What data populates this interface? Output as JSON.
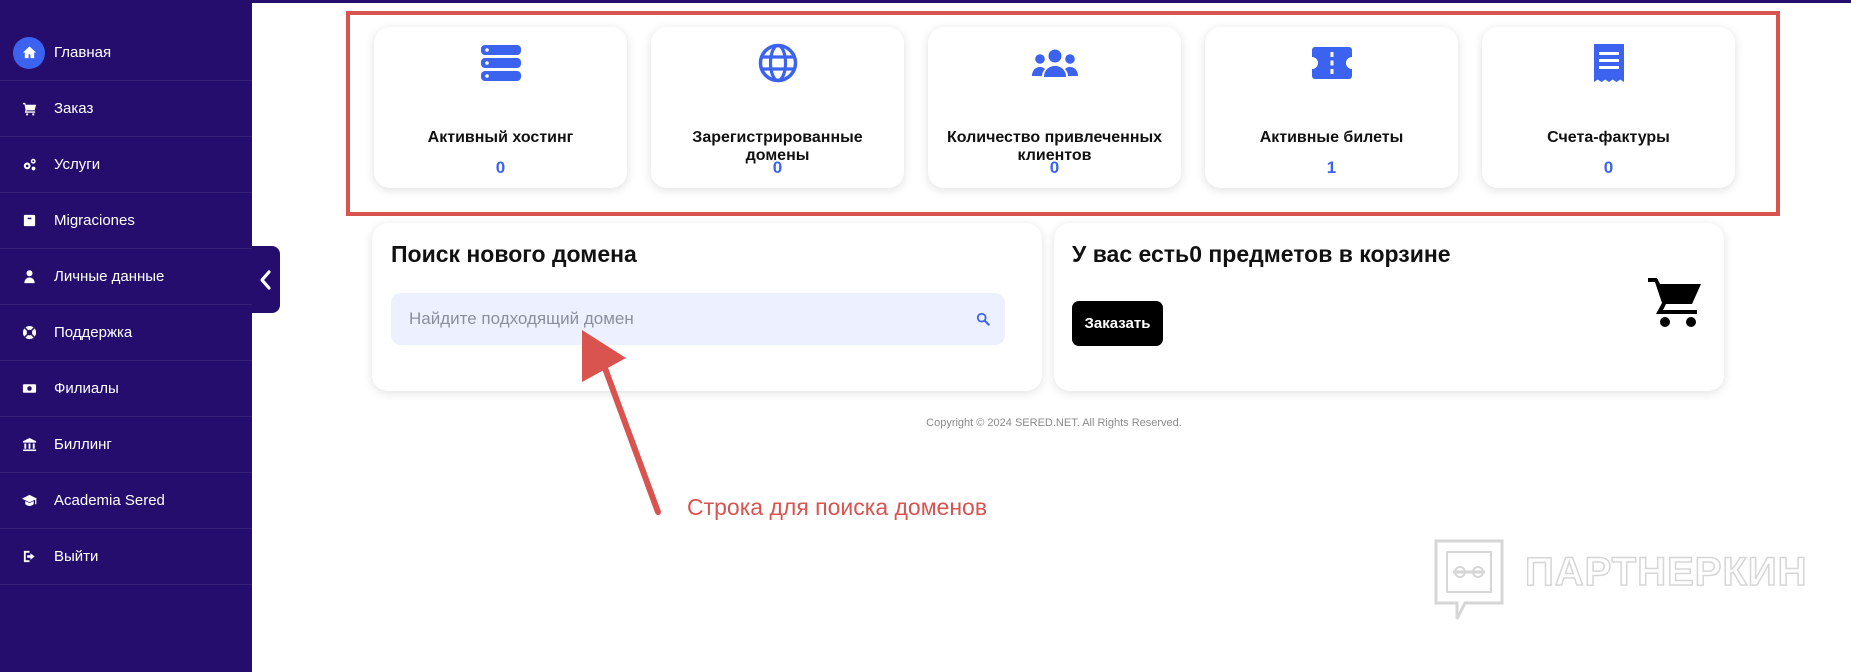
{
  "sidebar": {
    "items": [
      {
        "label": "Главная",
        "icon": "home-icon"
      },
      {
        "label": "Заказ",
        "icon": "cart-icon"
      },
      {
        "label": "Услуги",
        "icon": "gears-icon"
      },
      {
        "label": "Migraciones",
        "icon": "box-icon"
      },
      {
        "label": "Личные данные",
        "icon": "user-icon"
      },
      {
        "label": "Поддержка",
        "icon": "lifebuoy-icon"
      },
      {
        "label": "Филиалы",
        "icon": "money-icon"
      },
      {
        "label": "Биллинг",
        "icon": "bank-icon"
      },
      {
        "label": "Academia Sered",
        "icon": "graduation-cap-icon"
      },
      {
        "label": "Выйти",
        "icon": "logout-icon"
      }
    ],
    "active_index": 0
  },
  "stats": [
    {
      "label": "Активный хостинг",
      "value": "0",
      "icon": "server-icon"
    },
    {
      "label": "Зарегистрированные домены",
      "value": "0",
      "icon": "globe-icon"
    },
    {
      "label": "Количество привлеченных клиентов",
      "value": "0",
      "icon": "users-icon"
    },
    {
      "label": "Активные билеты",
      "value": "1",
      "icon": "ticket-icon"
    },
    {
      "label": "Счета-фактуры",
      "value": "0",
      "icon": "invoice-icon"
    }
  ],
  "domain_search": {
    "title": "Поиск нового домена",
    "placeholder": "Найдите подходящий домен"
  },
  "cart": {
    "title": "У вас есть0 предметов в корзине",
    "order_label": "Заказать"
  },
  "footer": {
    "copyright": "Copyright © 2024 SERED.NET. All Rights Reserved."
  },
  "annotation": {
    "text": "Строка для поиска доменов"
  },
  "watermark": {
    "text": "ПАРТНЕРКИН"
  },
  "colors": {
    "sidebar": "#250d6e",
    "accent": "#3b63f0",
    "highlight": "#d9534f",
    "search_bg": "#ecf0ff"
  }
}
